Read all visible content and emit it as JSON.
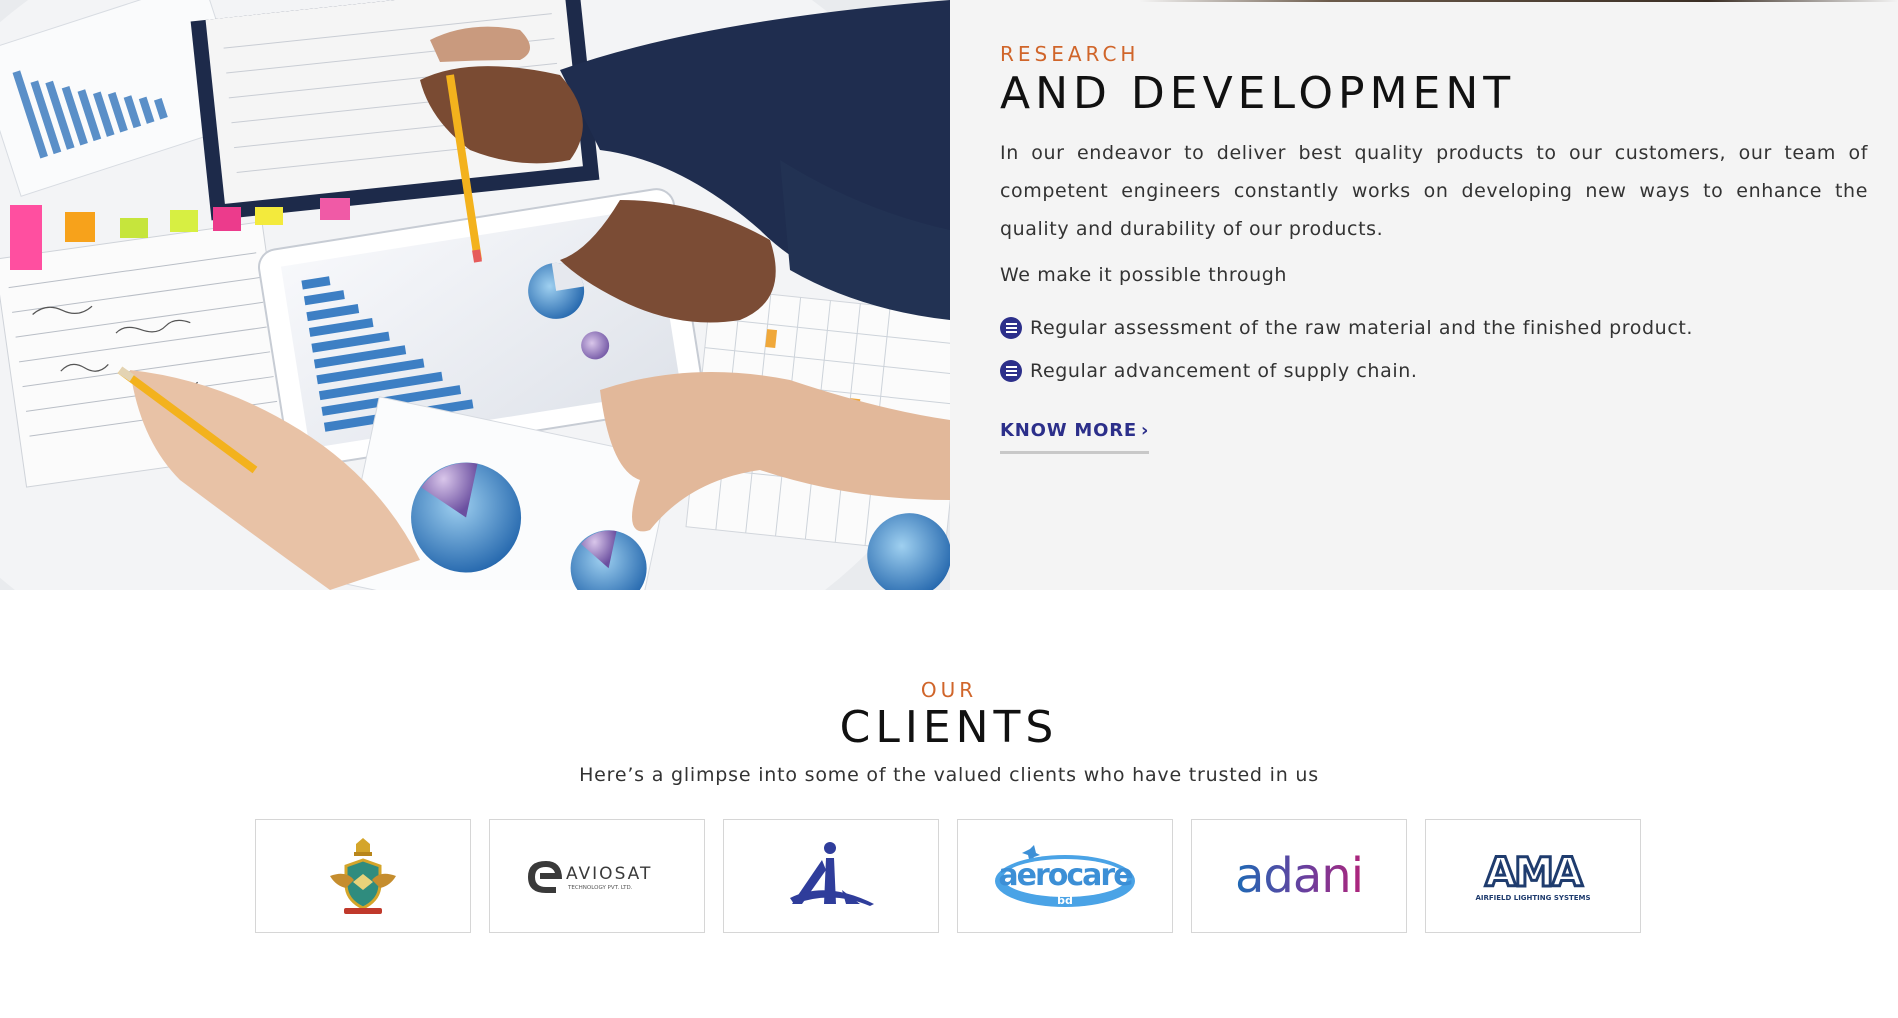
{
  "research": {
    "eyebrow": "RESEARCH",
    "title": "AND DEVELOPMENT",
    "description": "In our endeavor to deliver best quality products to our customers, our team of competent engineers constantly works on developing new ways to enhance the quality and durability of our products.",
    "lead": "We make it possible through",
    "points": [
      "Regular assessment of the raw material and the finished product.",
      "Regular advancement of supply chain."
    ],
    "cta_label": "KNOW MORE",
    "cta_icon": "chevron-right-icon"
  },
  "clients": {
    "eyebrow": "OUR",
    "title": "CLIENTS",
    "subtitle": "Here’s a glimpse into some of the valued clients who have trusted in us",
    "logos": [
      {
        "name": "air-force-crest-logo"
      },
      {
        "name": "aviosat-logo",
        "text": "AVIOSAT",
        "subtext": "TECHNOLOGY PVT. LTD."
      },
      {
        "name": "aai-logo"
      },
      {
        "name": "aerocare-logo",
        "text": "aerocare",
        "subtext": "bd"
      },
      {
        "name": "adani-logo",
        "text": "adani"
      },
      {
        "name": "ama-logo",
        "text": "AMA",
        "subtext": "AIRFIELD LIGHTING SYSTEMS"
      }
    ]
  },
  "colors": {
    "accent_orange": "#d0652a",
    "brand_navy": "#2c2f8a",
    "panel_bg": "#f4f4f4"
  }
}
